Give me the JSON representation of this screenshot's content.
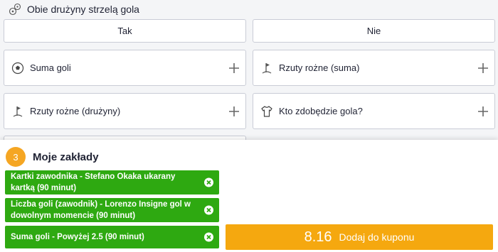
{
  "market_title": "Obie drużyny strzelą gola",
  "yes_no": {
    "yes": "Tak",
    "no": "Nie"
  },
  "markets": [
    {
      "label": "Suma goli",
      "icon": "soccer-ball-icon"
    },
    {
      "label": "Rzuty rożne (suma)",
      "icon": "corner-flag-icon"
    },
    {
      "label": "Rzuty rożne (drużyny)",
      "icon": "corner-flag-icon"
    },
    {
      "label": "Kto zdobędzie gola?",
      "icon": "shirt-icon"
    }
  ],
  "betslip": {
    "count": "3",
    "title": "Moje zakłady",
    "selections": [
      {
        "text": "Kartki zawodnika - Stefano Okaka ukarany kartką (90 minut)"
      },
      {
        "text": "Liczba goli (zawodnik) - Lorenzo Insigne gol w dowolnym momencie (90 minut)"
      },
      {
        "text": "Suma goli - Powyżej 2.5 (90 minut)"
      }
    ],
    "odds": "8.16",
    "add_label": "Dodaj do kuponu"
  },
  "colors": {
    "selection_green": "#2ea911",
    "accent_orange": "#f5a80f"
  }
}
